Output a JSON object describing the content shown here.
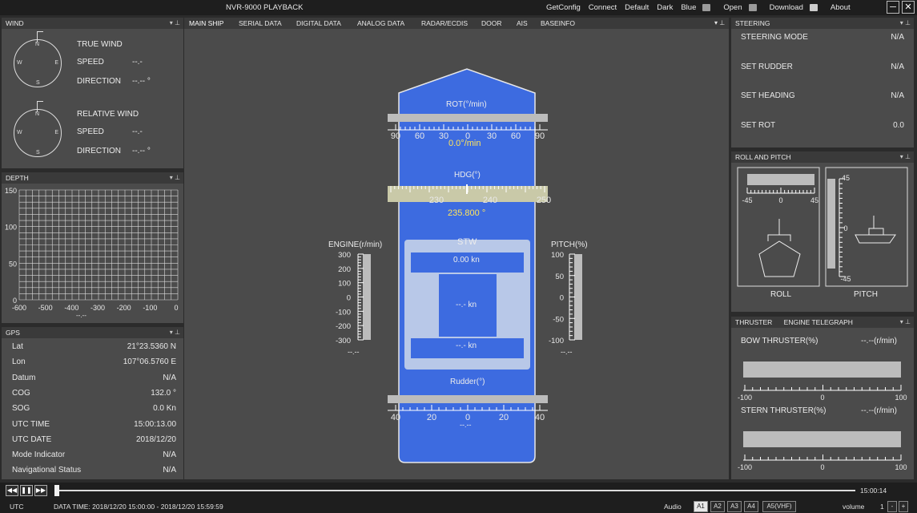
{
  "app": {
    "title": "NVR-9000 PLAYBACK"
  },
  "menu": [
    "GetConfig",
    "Connect",
    "Default",
    "Dark",
    "Blue",
    "Open",
    "Download",
    "About"
  ],
  "wind": {
    "panel_title": "WIND",
    "true": {
      "title": "TRUE WIND",
      "speed_label": "SPEED",
      "speed_value": "--.-",
      "direction_label": "DIRECTION",
      "direction_value": "--.-- °"
    },
    "relative": {
      "title": "RELATIVE WIND",
      "speed_label": "SPEED",
      "speed_value": "--.-",
      "direction_label": "DIRECTION",
      "direction_value": "--.-- °"
    },
    "compass": {
      "n": "N",
      "e": "E",
      "s": "S",
      "w": "W"
    }
  },
  "depth": {
    "panel_title": "DEPTH",
    "y_ticks": [
      "150",
      "100",
      "50",
      "0"
    ],
    "x_ticks": [
      "-600",
      "-500",
      "-400",
      "-300",
      "-200",
      "-100",
      "0"
    ],
    "value": "--.--"
  },
  "gps": {
    "panel_title": "GPS",
    "rows": [
      {
        "label": "Lat",
        "value": "21°23.5360 N"
      },
      {
        "label": "Lon",
        "value": "107°06.5760 E"
      },
      {
        "label": "Datum",
        "value": "N/A"
      },
      {
        "label": "COG",
        "value": "132.0 °"
      },
      {
        "label": "SOG",
        "value": "0.0 Kn"
      },
      {
        "label": "UTC TIME",
        "value": "15:00:13.00"
      },
      {
        "label": "UTC DATE",
        "value": "2018/12/20"
      },
      {
        "label": "Mode Indicator",
        "value": "N/A"
      },
      {
        "label": "Navigational Status",
        "value": "N/A"
      }
    ]
  },
  "tabs": [
    "MAIN SHIP",
    "SERIAL DATA",
    "DIGITAL DATA",
    "ANALOG DATA",
    "RADAR/ECDIS",
    "DOOR",
    "AIS",
    "BASEINFO"
  ],
  "ship": {
    "rot_label": "ROT(°/min)",
    "rot_ticks": [
      "90",
      "60",
      "30",
      "0",
      "30",
      "60",
      "90"
    ],
    "rot_value": "0.0°/min",
    "hdg_label": "HDG(°)",
    "hdg_ticks": [
      "230",
      "240",
      "250"
    ],
    "hdg_value": "235.800 °",
    "stw_label": "STW",
    "stw_value": "0.00 kn",
    "center_value": "--.- kn",
    "bottom_value": "--.- kn",
    "rudder_label": "Rudder(°)",
    "rudder_ticks": [
      "40",
      "20",
      "0",
      "20",
      "40"
    ],
    "rudder_value": "--.--",
    "engine_label": "ENGINE(r/min)",
    "engine_ticks": [
      "300",
      "200",
      "100",
      "0",
      "-100",
      "-200",
      "-300"
    ],
    "engine_value": "--.--",
    "pitch_label": "PITCH(%)",
    "pitch_ticks": [
      "100",
      "50",
      "0",
      "-50",
      "-100"
    ],
    "pitch_value": "--.--"
  },
  "steering": {
    "panel_title": "STEERING",
    "rows": [
      {
        "label": "STEERING MODE",
        "value": "N/A"
      },
      {
        "label": "SET RUDDER",
        "value": "N/A"
      },
      {
        "label": "SET HEADING",
        "value": "N/A"
      },
      {
        "label": "SET ROT",
        "value": "0.0"
      }
    ]
  },
  "roll_pitch": {
    "panel_title": "ROLL AND PITCH",
    "roll_ticks": [
      "-45",
      "0",
      "45"
    ],
    "pitch_ticks": [
      "45",
      "0",
      "-45"
    ],
    "roll_label": "ROLL",
    "pitch_label": "PITCH"
  },
  "thruster": {
    "tab1": "THRUSTER",
    "tab2": "ENGINE TELEGRAPH",
    "bow_label": "BOW THRUSTER(%)",
    "bow_value": "--.--(r/min)",
    "stern_label": "STERN THRUSTER(%)",
    "stern_value": "--.--(r/min)",
    "ticks": [
      "-100",
      "0",
      "100"
    ]
  },
  "playback": {
    "current_time": "15:00:14",
    "tz": "UTC",
    "data_time": "DATA TIME: 2018/12/20 15:00:00 - 2018/12/20 15:59:59",
    "audio_label": "Audio",
    "channels": [
      "A1",
      "A2",
      "A3",
      "A4",
      "A5(VHF)"
    ],
    "volume_label": "volume",
    "volume_value": "1"
  },
  "colors": {
    "ship": "#3d6be0",
    "panel": "#4b4b4b",
    "title": "#3a3a3a",
    "value_yellow": "#ffe45c"
  }
}
